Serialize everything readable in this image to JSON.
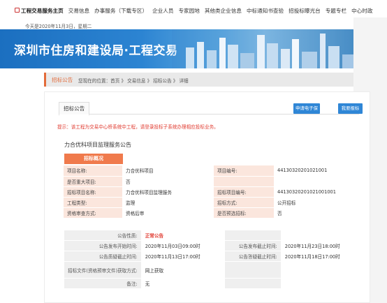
{
  "topnav": {
    "items": [
      "工程交易服务主页",
      "交易信息",
      "办事服务（下载专区）",
      "企业人员",
      "专家园地",
      "其他类企业信息",
      "中标通知书查验",
      "招投标曝光台",
      "专题专栏",
      "中心时政"
    ]
  },
  "dateline": "今天是2020年11月3日，星期二",
  "banner": {
    "title": "深圳市住房和建设局·工程交易"
  },
  "breadcrumb": {
    "current": "招标公告",
    "path": "您现在的位置：首页 》 交易信息 》 招标公告 》 详细"
  },
  "panel": {
    "tab": "招标公告",
    "btn_electronic": "申请电子保函",
    "btn_signup": "我要报标",
    "notice": "提示：该工程为交易中心桥系统中工程，请登录投标子系统办理相应投标业务。",
    "project_title": "力合优科项目监理服务公告"
  },
  "section": {
    "header": "招标概况"
  },
  "overview": [
    [
      "项目名称:",
      "力合优科项目",
      "项目编号:",
      "44130320201021001"
    ],
    [
      "是否重大项目:",
      "否",
      "",
      ""
    ],
    [
      "招标项目名称:",
      "力合优科项目监理服务",
      "招标项目编号:",
      "44130320201021001001"
    ],
    [
      "工程类型:",
      "监理",
      "招标方式:",
      "公开招标"
    ],
    [
      "资格审查方式:",
      "资格后审",
      "是否预选招标:",
      "否"
    ]
  ],
  "announce": [
    [
      "公告性质:",
      "正常公告",
      "",
      ""
    ],
    [
      "公告发布开始时间:",
      "2020年11月03日09:00时",
      "公告发布截止时间:",
      "2020年11月23日18:00时"
    ],
    [
      "公告质疑截止时间:",
      "2020年11月13日17:00时",
      "公告答疑截止时间:",
      "2020年11月18日17:00时"
    ],
    [
      "招标文件(资格预审文件)获取方式:",
      "网上获取",
      "",
      ""
    ],
    [
      "备注:",
      "无",
      "",
      ""
    ]
  ],
  "colors": {
    "accent": "#f07a4c",
    "button": "#2f86d6",
    "notice": "#e03a2f",
    "banner": "#1b6fc0"
  }
}
